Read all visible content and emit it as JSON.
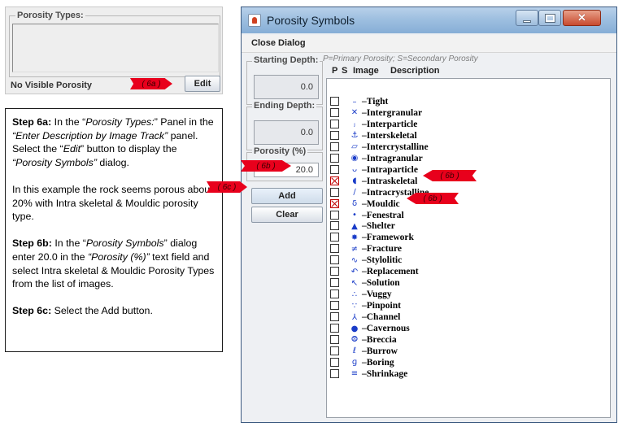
{
  "porosity_types_panel": {
    "title": "Porosity Types:",
    "status": "No Visible Porosity",
    "edit_label": "Edit"
  },
  "callouts": {
    "c6a": "( 6a )",
    "c6b_depth": "( 6b )",
    "c6b_list": "( 6b )",
    "c6b_mouldic": "( 6b )",
    "c6c": "( 6c )"
  },
  "instructions": {
    "p1_step": "Step 6a:",
    "p1_a": " In the “",
    "p1_b": "Porosity Types:",
    "p1_c": "” Panel in the ",
    "p1_d": "“Enter Description by Image Track”",
    "p1_e": " panel.  Select the “",
    "p1_f": "Edit",
    "p1_g": "” button to display the ",
    "p1_h": "“Porosity Symbols”",
    "p1_i": " dialog.",
    "p2": "In this example the rock seems porous about 20% with Intra skeletal & Mouldic porosity type.",
    "p3_step": "Step 6b:",
    "p3_a": " In the “",
    "p3_b": "Porosity Symbols",
    "p3_c": "” dialog enter 20.0 in the ",
    "p3_d": "“Porosity (%)”",
    "p3_e": " text field and select Intra skeletal  & Mouldic Porosity Types from the list of images.",
    "p4_step": "Step 6c:",
    "p4_a": " Select the Add button."
  },
  "dialog": {
    "title": "Porosity Symbols",
    "menu_close": "Close Dialog",
    "starting_depth_label": "Starting Depth:",
    "starting_depth_value": "0.0",
    "ending_depth_label": "Ending Depth:",
    "ending_depth_value": "0.0",
    "porosity_label": "Porosity (%)",
    "porosity_value": "20.0",
    "add_label": "Add",
    "clear_label": "Clear",
    "hint": "P=Primary Porosity; S=Secondary Porosity",
    "col_p": "P",
    "col_s": "S",
    "col_image": "Image",
    "col_desc": "Description"
  },
  "symbols": [
    {
      "label": "–Tight",
      "icon": "dash-icon",
      "glyph": "–",
      "checked": false
    },
    {
      "label": "–Intergranular",
      "icon": "cross-icon",
      "glyph": "✕",
      "checked": false
    },
    {
      "label": "–Interparticle",
      "icon": "interparticle-icon",
      "glyph": "ⱼ",
      "checked": false
    },
    {
      "label": "–Interskeletal",
      "icon": "interskeletal-icon",
      "glyph": "⚓",
      "checked": false
    },
    {
      "label": "–Intercrystalline",
      "icon": "parallelogram-icon",
      "glyph": "▱",
      "checked": false
    },
    {
      "label": "–Intragranular",
      "icon": "ring-dot-icon",
      "glyph": "◉",
      "checked": false
    },
    {
      "label": "–Intraparticle",
      "icon": "intraparticle-icon",
      "glyph": "ᴗ",
      "checked": false
    },
    {
      "label": "–Intraskeletal",
      "icon": "drop-icon",
      "glyph": "◖",
      "checked": true
    },
    {
      "label": "–Intracrystalline",
      "icon": "slash-icon",
      "glyph": "∕",
      "checked": false
    },
    {
      "label": "–Mouldic",
      "icon": "mould-icon",
      "glyph": "δ",
      "checked": true
    },
    {
      "label": "–Fenestral",
      "icon": "fenestral-icon",
      "glyph": "•",
      "checked": false
    },
    {
      "label": "–Shelter",
      "icon": "shelter-icon",
      "glyph": "▲",
      "checked": false
    },
    {
      "label": "–Framework",
      "icon": "framework-icon",
      "glyph": "✸",
      "checked": false
    },
    {
      "label": "–Fracture",
      "icon": "fracture-icon",
      "glyph": "≠",
      "checked": false
    },
    {
      "label": "–Stylolitic",
      "icon": "stylolite-icon",
      "glyph": "∿",
      "checked": false
    },
    {
      "label": "–Replacement",
      "icon": "replacement-icon",
      "glyph": "↶",
      "checked": false
    },
    {
      "label": "–Solution",
      "icon": "arrow-nw-icon",
      "glyph": "↖",
      "checked": false
    },
    {
      "label": "–Vuggy",
      "icon": "vuggy-icon",
      "glyph": "∴",
      "checked": false
    },
    {
      "label": "–Pinpoint",
      "icon": "dots-icon",
      "glyph": "∵",
      "checked": false
    },
    {
      "label": "–Channel",
      "icon": "channel-icon",
      "glyph": "⅄",
      "checked": false
    },
    {
      "label": "–Cavernous",
      "icon": "filled-circle-icon",
      "glyph": "●",
      "checked": false
    },
    {
      "label": "–Breccia",
      "icon": "breccia-icon",
      "glyph": "⨷",
      "checked": false
    },
    {
      "label": "–Burrow",
      "icon": "burrow-icon",
      "glyph": "ℓ",
      "checked": false
    },
    {
      "label": "–Boring",
      "icon": "boring-icon",
      "glyph": "ɡ",
      "checked": false
    },
    {
      "label": "–Shrinkage",
      "icon": "triple-line-icon",
      "glyph": "≡",
      "checked": false
    }
  ],
  "colors": {
    "callout_red": "#e8001c",
    "symbol_blue": "#1a3cc8",
    "check_red": "#c00000"
  }
}
